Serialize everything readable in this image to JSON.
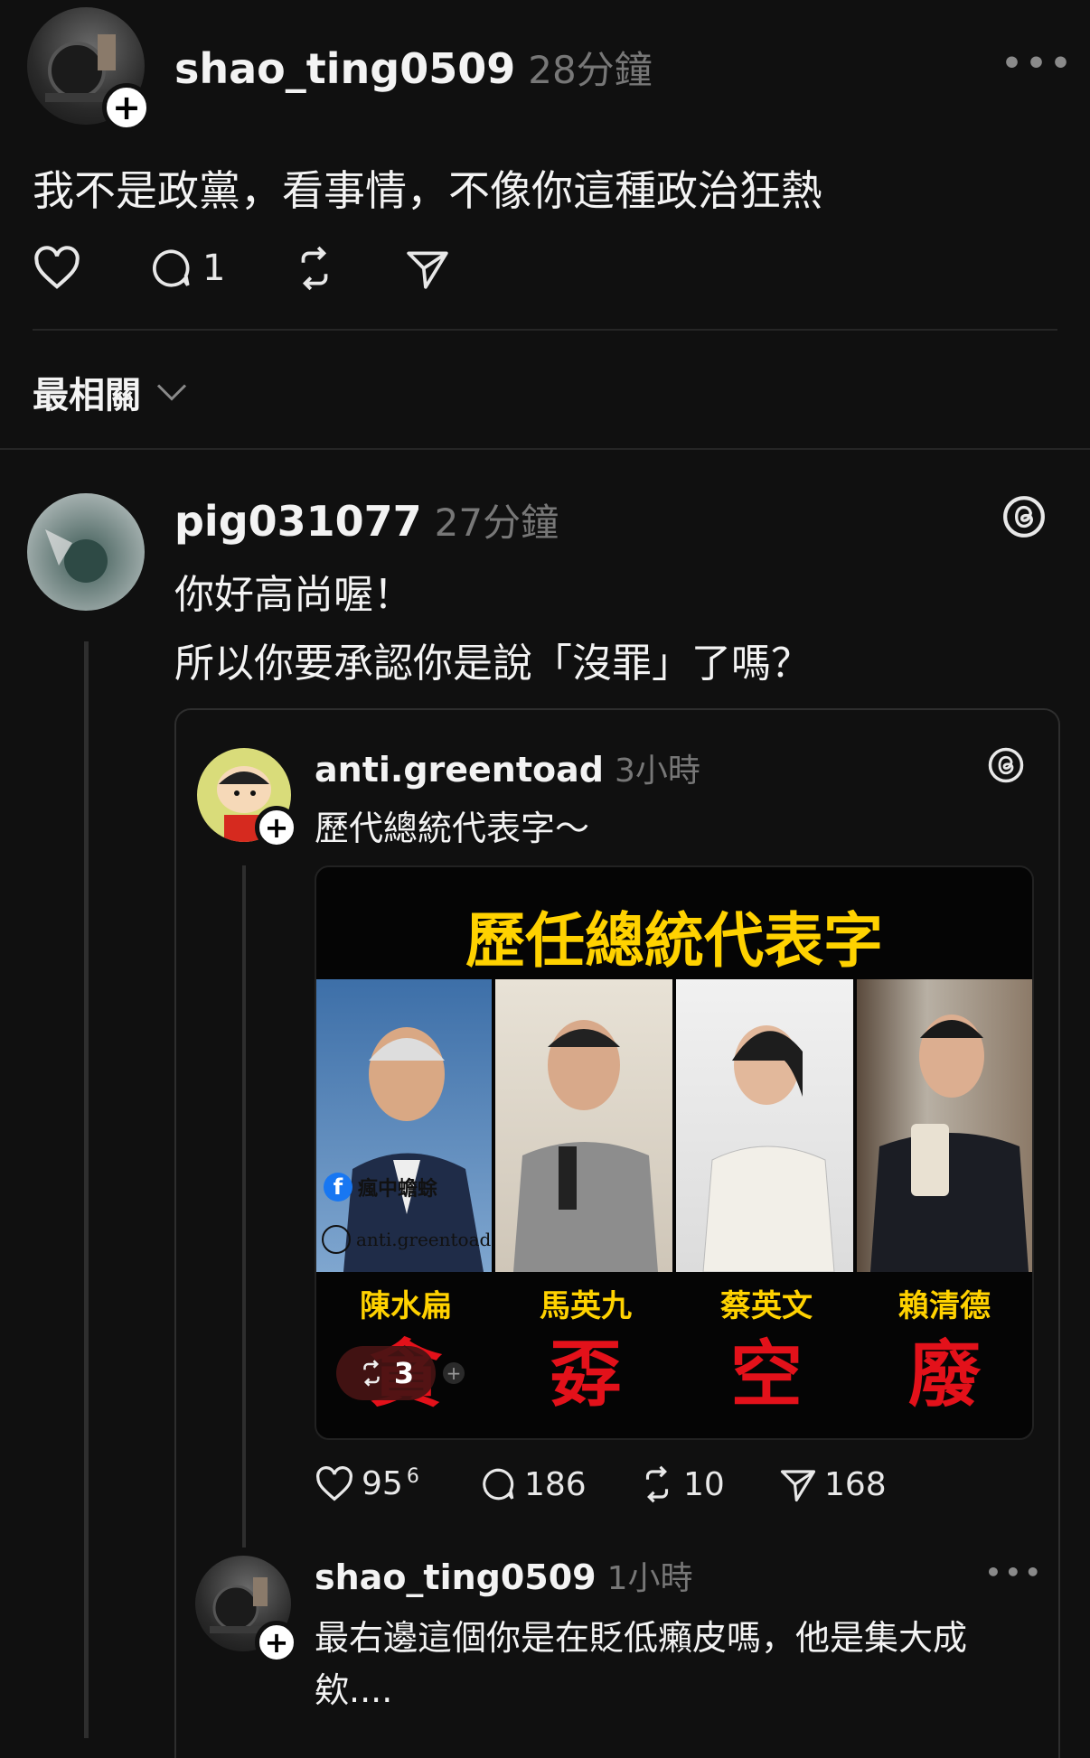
{
  "post": {
    "username": "shao_ting0509",
    "time": "28分鐘",
    "text": "我不是政黨，看事情，不像你這種政治狂熱",
    "reply_count": "1"
  },
  "sort": {
    "label": "最相關"
  },
  "reply": {
    "username": "pig031077",
    "time": "27分鐘",
    "line1": "你好高尚喔！",
    "line2": "所以你要承認你是說「沒罪」了嗎？"
  },
  "quoted": {
    "username": "anti.greentoad",
    "time": "3小時",
    "text": "歷代總統代表字～",
    "image": {
      "title": "歷任總統代表字",
      "watermark_handle": "anti.greentoad",
      "watermark_fb": "瘋中蟾蜍",
      "presidents": [
        {
          "name": "陳水扁",
          "char": "貪"
        },
        {
          "name": "馬英九",
          "char": "孬"
        },
        {
          "name": "蔡英文",
          "char": "空"
        },
        {
          "name": "賴清德",
          "char": "廢"
        }
      ],
      "overlay_repost_count": "3"
    },
    "likes": "95",
    "likes_sup": "6",
    "comments": "186",
    "reposts": "10",
    "shares": "168"
  },
  "nested": {
    "username": "shao_ting0509",
    "time": "1小時",
    "line1": "最右邊這個你是在貶低癩皮嗎，他是集大成",
    "line2": "欸...."
  },
  "colors": {
    "background": "#101010",
    "title_yellow": "#ffd200",
    "red": "#e3111a"
  }
}
